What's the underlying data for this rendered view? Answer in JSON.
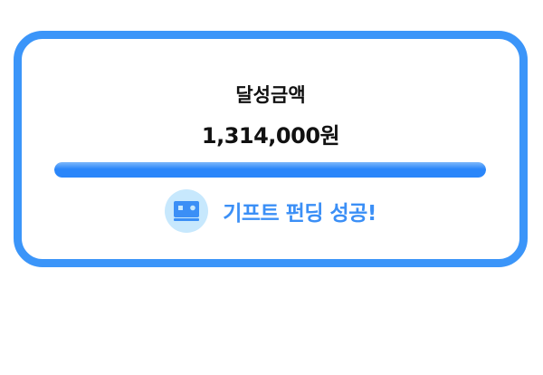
{
  "card": {
    "label": "달성금액",
    "amount": "1,314,000원",
    "progress_percent": 100,
    "status_icon": "gift-card-icon",
    "status_text": "기프트 펀딩 성공!",
    "colors": {
      "border": "#3b95f9",
      "progress": "#2a86fa",
      "status": "#3b8ff6",
      "icon_bg": "#c7e8fd"
    }
  }
}
